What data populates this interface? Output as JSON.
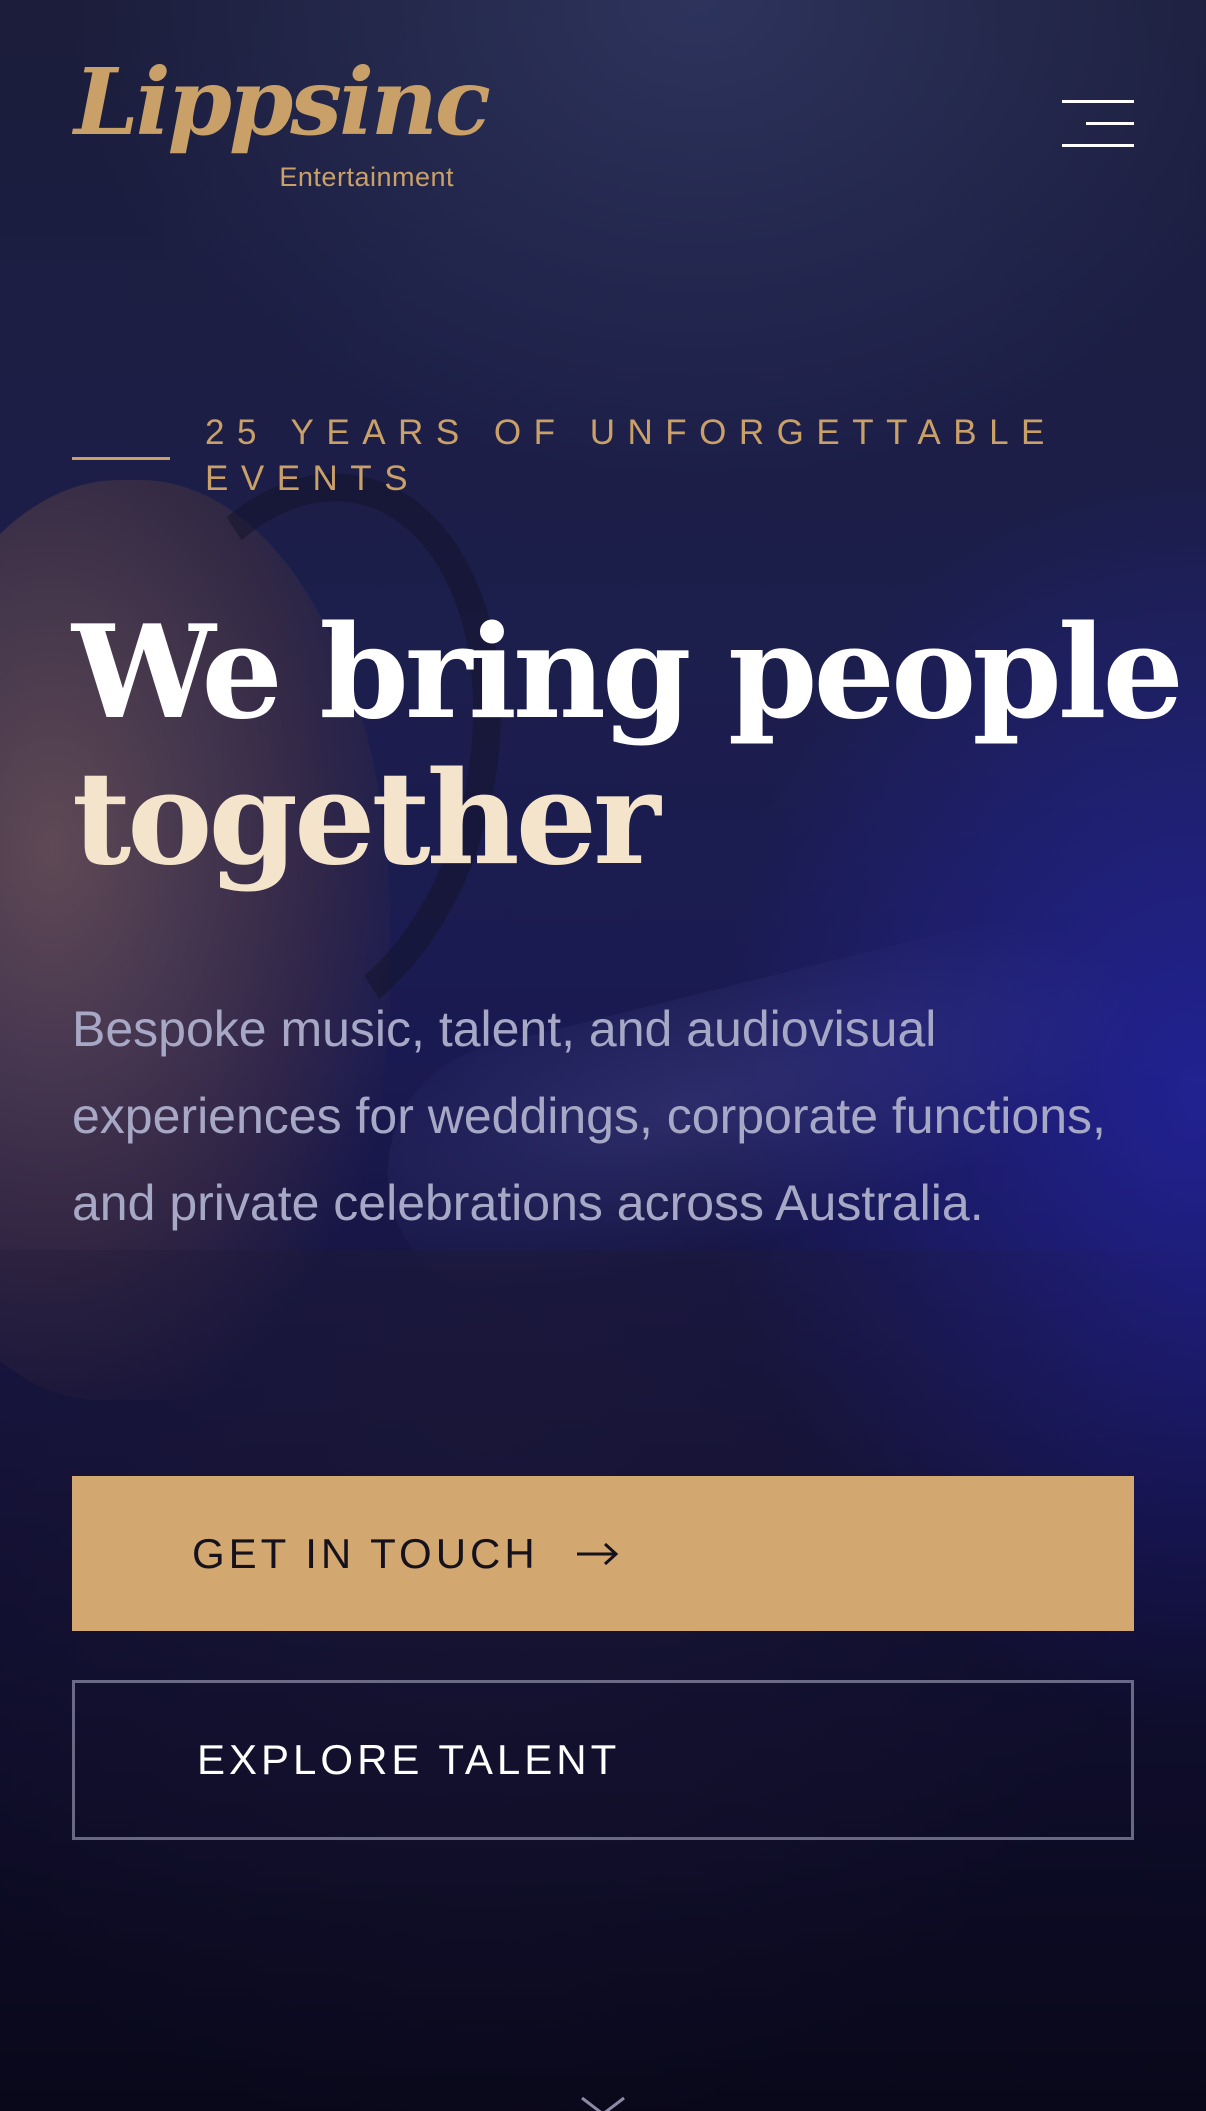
{
  "brand": {
    "logo_main": "Lippsinc",
    "logo_sub": "Entertainment",
    "accent_color": "#c9a068"
  },
  "header": {
    "menu_icon": "hamburger-menu-icon"
  },
  "hero": {
    "eyebrow": "25 YEARS OF UNFORGETTABLE EVENTS",
    "headline_line1": "We bring people",
    "headline_line2": "together",
    "subtext": "Bespoke music, talent, and audiovisual experiences for weddings, corporate functions, and private celebrations across Australia.",
    "primary_button": {
      "label": "GET IN TOUCH",
      "icon": "arrow-right-icon",
      "background": "#d3a870"
    },
    "secondary_button": {
      "label": "EXPLORE TALENT"
    },
    "scroll_icon": "chevron-down-icon"
  }
}
